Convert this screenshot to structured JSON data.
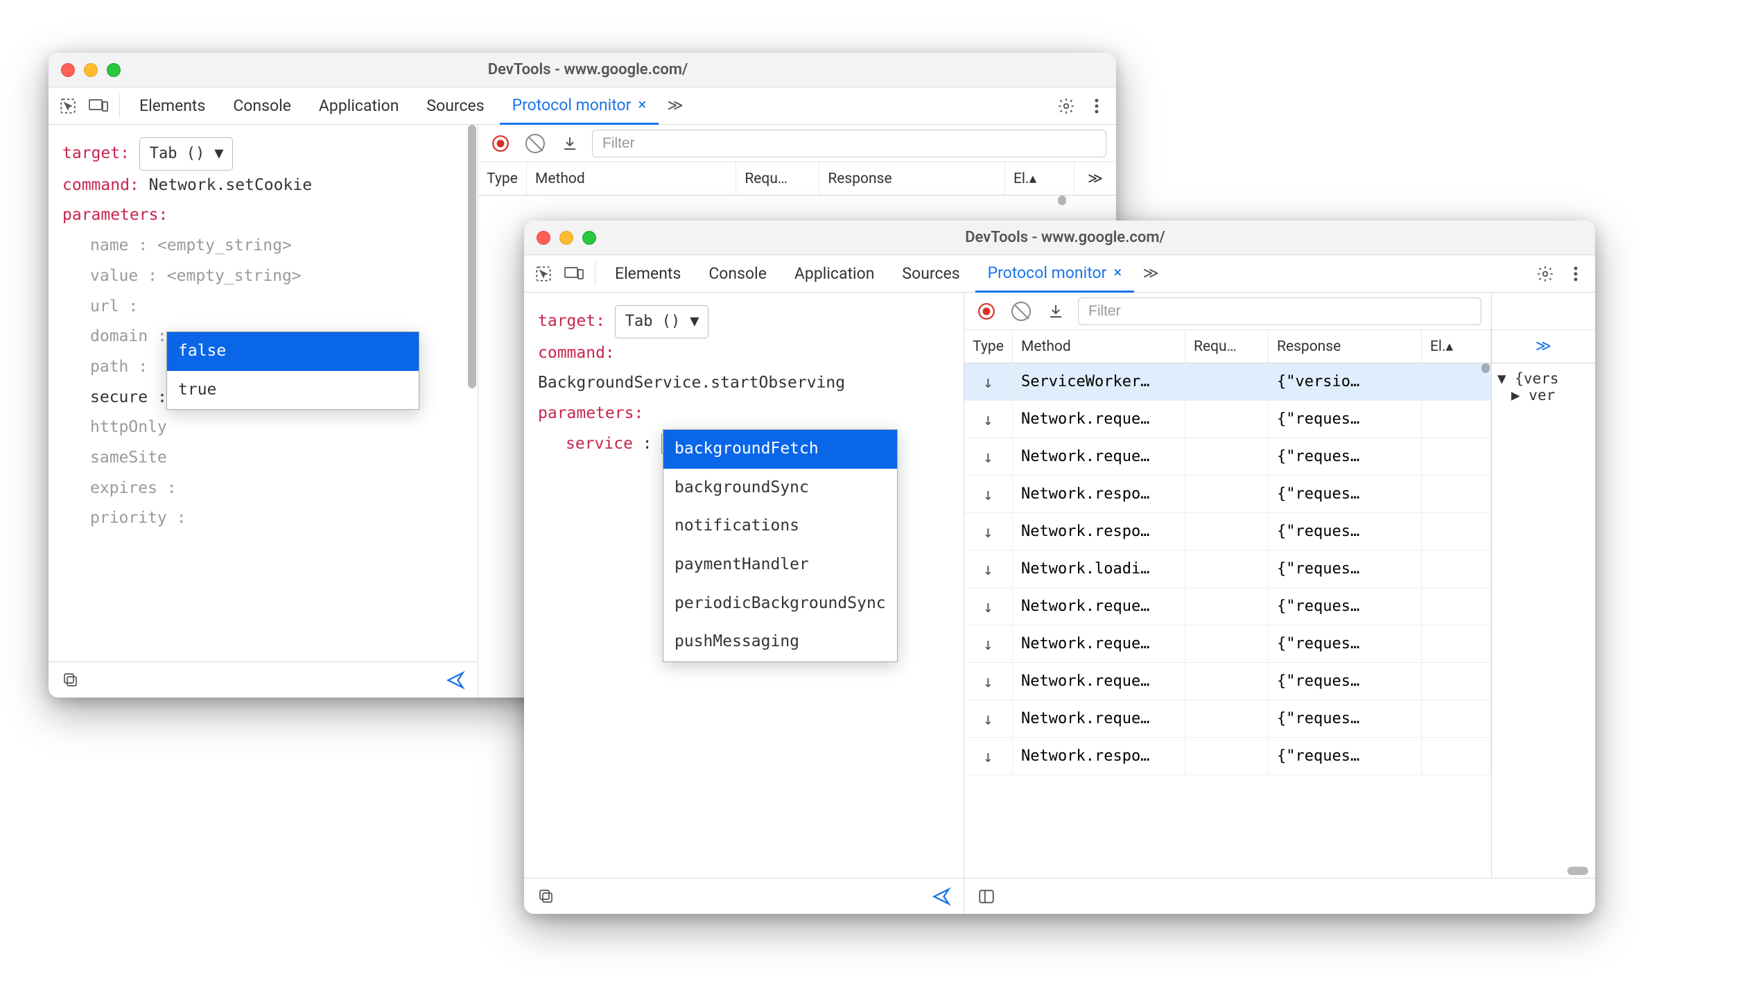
{
  "window_back": {
    "title": "DevTools - www.google.com/",
    "tabs": [
      "Elements",
      "Console",
      "Application",
      "Sources",
      "Protocol monitor"
    ],
    "active_tab": "Protocol monitor",
    "editor": {
      "target_label": "target:",
      "target_value": "Tab ()",
      "command_label": "command:",
      "command_value": "Network.setCookie",
      "parameters_label": "parameters:",
      "params": [
        {
          "key": "name",
          "val": "<empty_string>"
        },
        {
          "key": "value",
          "val": "<empty_string>"
        },
        {
          "key": "url",
          "val": ""
        },
        {
          "key": "domain",
          "val": ""
        },
        {
          "key": "path",
          "val": ""
        },
        {
          "key": "secure",
          "val": "false"
        },
        {
          "key": "httpOnly",
          "val": ""
        },
        {
          "key": "sameSite",
          "val": ""
        },
        {
          "key": "expires",
          "val": ""
        },
        {
          "key": "priority",
          "val": ""
        }
      ],
      "dropdown": [
        "false",
        "true"
      ]
    },
    "toolbar": {
      "filter_placeholder": "Filter"
    },
    "columns": {
      "type": "Type",
      "method": "Method",
      "request": "Requ…",
      "response": "Response",
      "el": "El.▴",
      "more": "≫"
    }
  },
  "window_front": {
    "title": "DevTools - www.google.com/",
    "tabs": [
      "Elements",
      "Console",
      "Application",
      "Sources",
      "Protocol monitor"
    ],
    "active_tab": "Protocol monitor",
    "editor": {
      "target_label": "target:",
      "target_value": "Tab ()",
      "command_label": "command:",
      "command_value": "BackgroundService.startObserving",
      "parameters_label": "parameters:",
      "params": [
        {
          "key": "service",
          "val": ""
        }
      ],
      "dropdown": [
        "backgroundFetch",
        "backgroundSync",
        "notifications",
        "paymentHandler",
        "periodicBackgroundSync",
        "pushMessaging"
      ]
    },
    "toolbar": {
      "filter_placeholder": "Filter"
    },
    "columns": {
      "type": "Type",
      "method": "Method",
      "request": "Requ…",
      "response": "Response",
      "el": "El.▴",
      "more": "≫"
    },
    "rows": [
      {
        "method": "ServiceWorker…",
        "response": "{\"versio…"
      },
      {
        "method": "Network.reque…",
        "response": "{\"reques…"
      },
      {
        "method": "Network.reque…",
        "response": "{\"reques…"
      },
      {
        "method": "Network.respo…",
        "response": "{\"reques…"
      },
      {
        "method": "Network.respo…",
        "response": "{\"reques…"
      },
      {
        "method": "Network.loadi…",
        "response": "{\"reques…"
      },
      {
        "method": "Network.reque…",
        "response": "{\"reques…"
      },
      {
        "method": "Network.reque…",
        "response": "{\"reques…"
      },
      {
        "method": "Network.reque…",
        "response": "{\"reques…"
      },
      {
        "method": "Network.reque…",
        "response": "{\"reques…"
      },
      {
        "method": "Network.respo…",
        "response": "{\"reques…"
      }
    ],
    "side": {
      "line1": "{vers",
      "line2": "ver"
    }
  }
}
